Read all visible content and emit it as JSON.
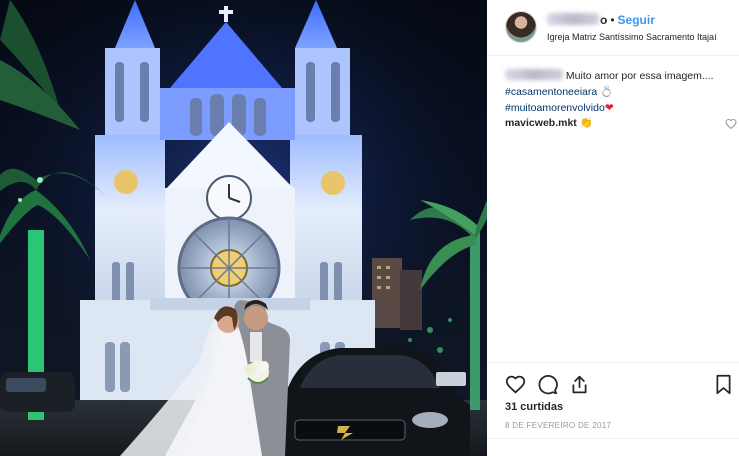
{
  "post": {
    "username_visible": "o",
    "follow_label": "Seguir",
    "location": "Igreja Matriz Santíssimo Sacramento Itajaí",
    "caption_text": "Muito amor por essa imagem....",
    "hashtags": [
      "#casamentoneeiara",
      "#muitoamorenvolvido"
    ],
    "ring_emoji": "💍",
    "heart_emoji": "❤",
    "comments": [
      {
        "username": "mavicweb.mkt",
        "text": "👏"
      }
    ],
    "likes": "31 curtidas",
    "date": "8 DE FEVEREIRO DE 2017"
  },
  "icons": {
    "like": "heart-icon",
    "comment": "comment-icon",
    "share": "share-icon",
    "save": "bookmark-icon",
    "comment_like": "heart-icon"
  },
  "colors": {
    "follow": "#3897f0",
    "hashtag": "#003569",
    "church_light": "#cfe0ff",
    "church_glow": "#3b6dff"
  }
}
